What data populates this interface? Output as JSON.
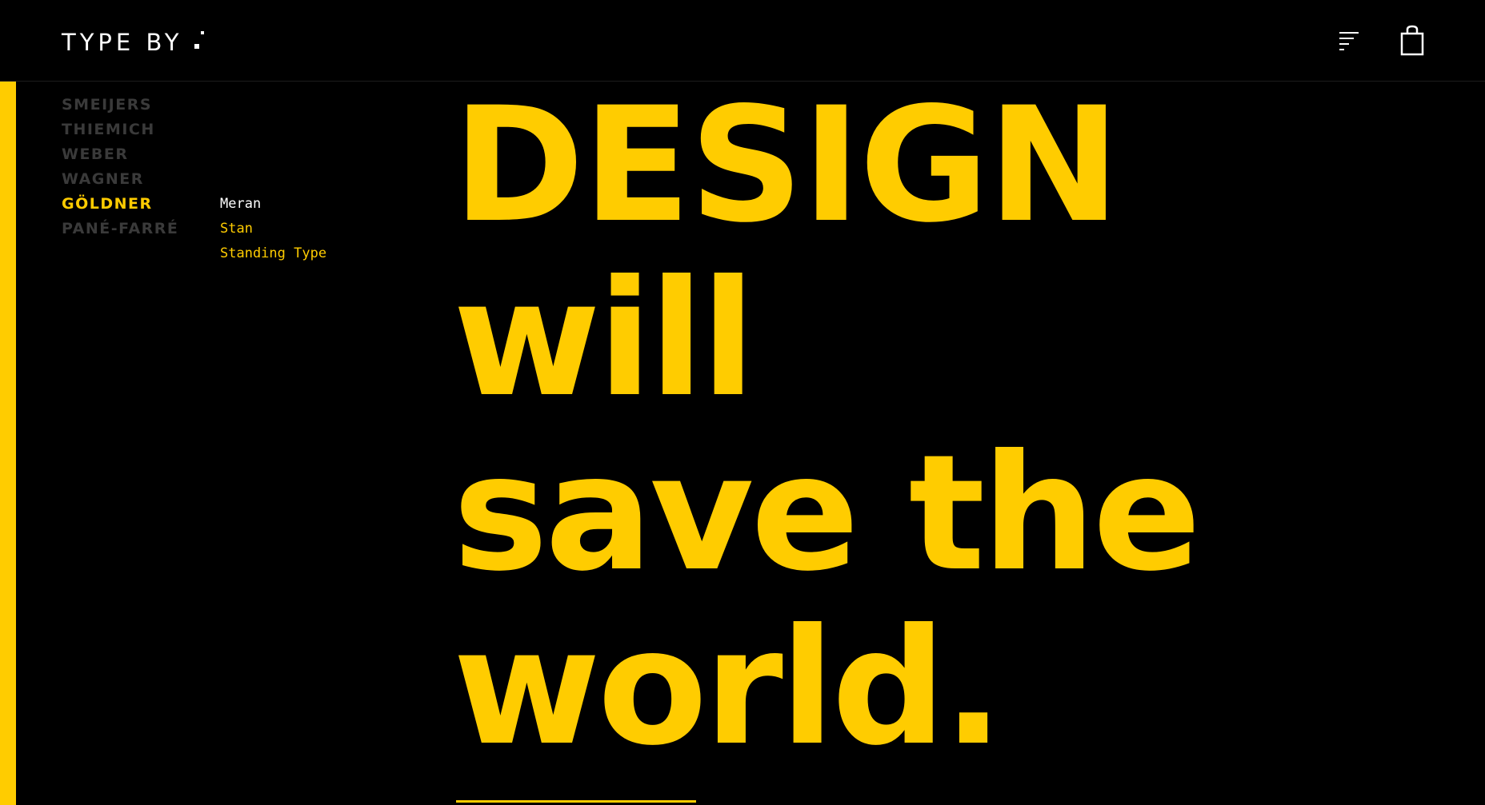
{
  "header": {
    "logo_text": "TYPE BY",
    "menu_icon": "menu-lines-icon",
    "cart_icon": "shopping-bag-icon"
  },
  "sidebar": {
    "designers": [
      {
        "label": "SMEIJERS",
        "active": false
      },
      {
        "label": "THIEMICH",
        "active": false
      },
      {
        "label": "WEBER",
        "active": false
      },
      {
        "label": "WAGNER",
        "active": false
      },
      {
        "label": "GÖLDNER",
        "active": true
      },
      {
        "label": "PANÉ-FARRÉ",
        "active": false
      }
    ],
    "fonts": [
      {
        "label": "Meran",
        "current": true
      },
      {
        "label": "Stan",
        "current": false
      },
      {
        "label": "Standing Type",
        "current": false
      }
    ]
  },
  "hero": {
    "lines": [
      "DESIGN",
      "will",
      "save the",
      "world."
    ]
  },
  "colors": {
    "background": "#000000",
    "accent": "#ffcc00",
    "text": "#ffffff",
    "muted": "#3a3a3a"
  }
}
